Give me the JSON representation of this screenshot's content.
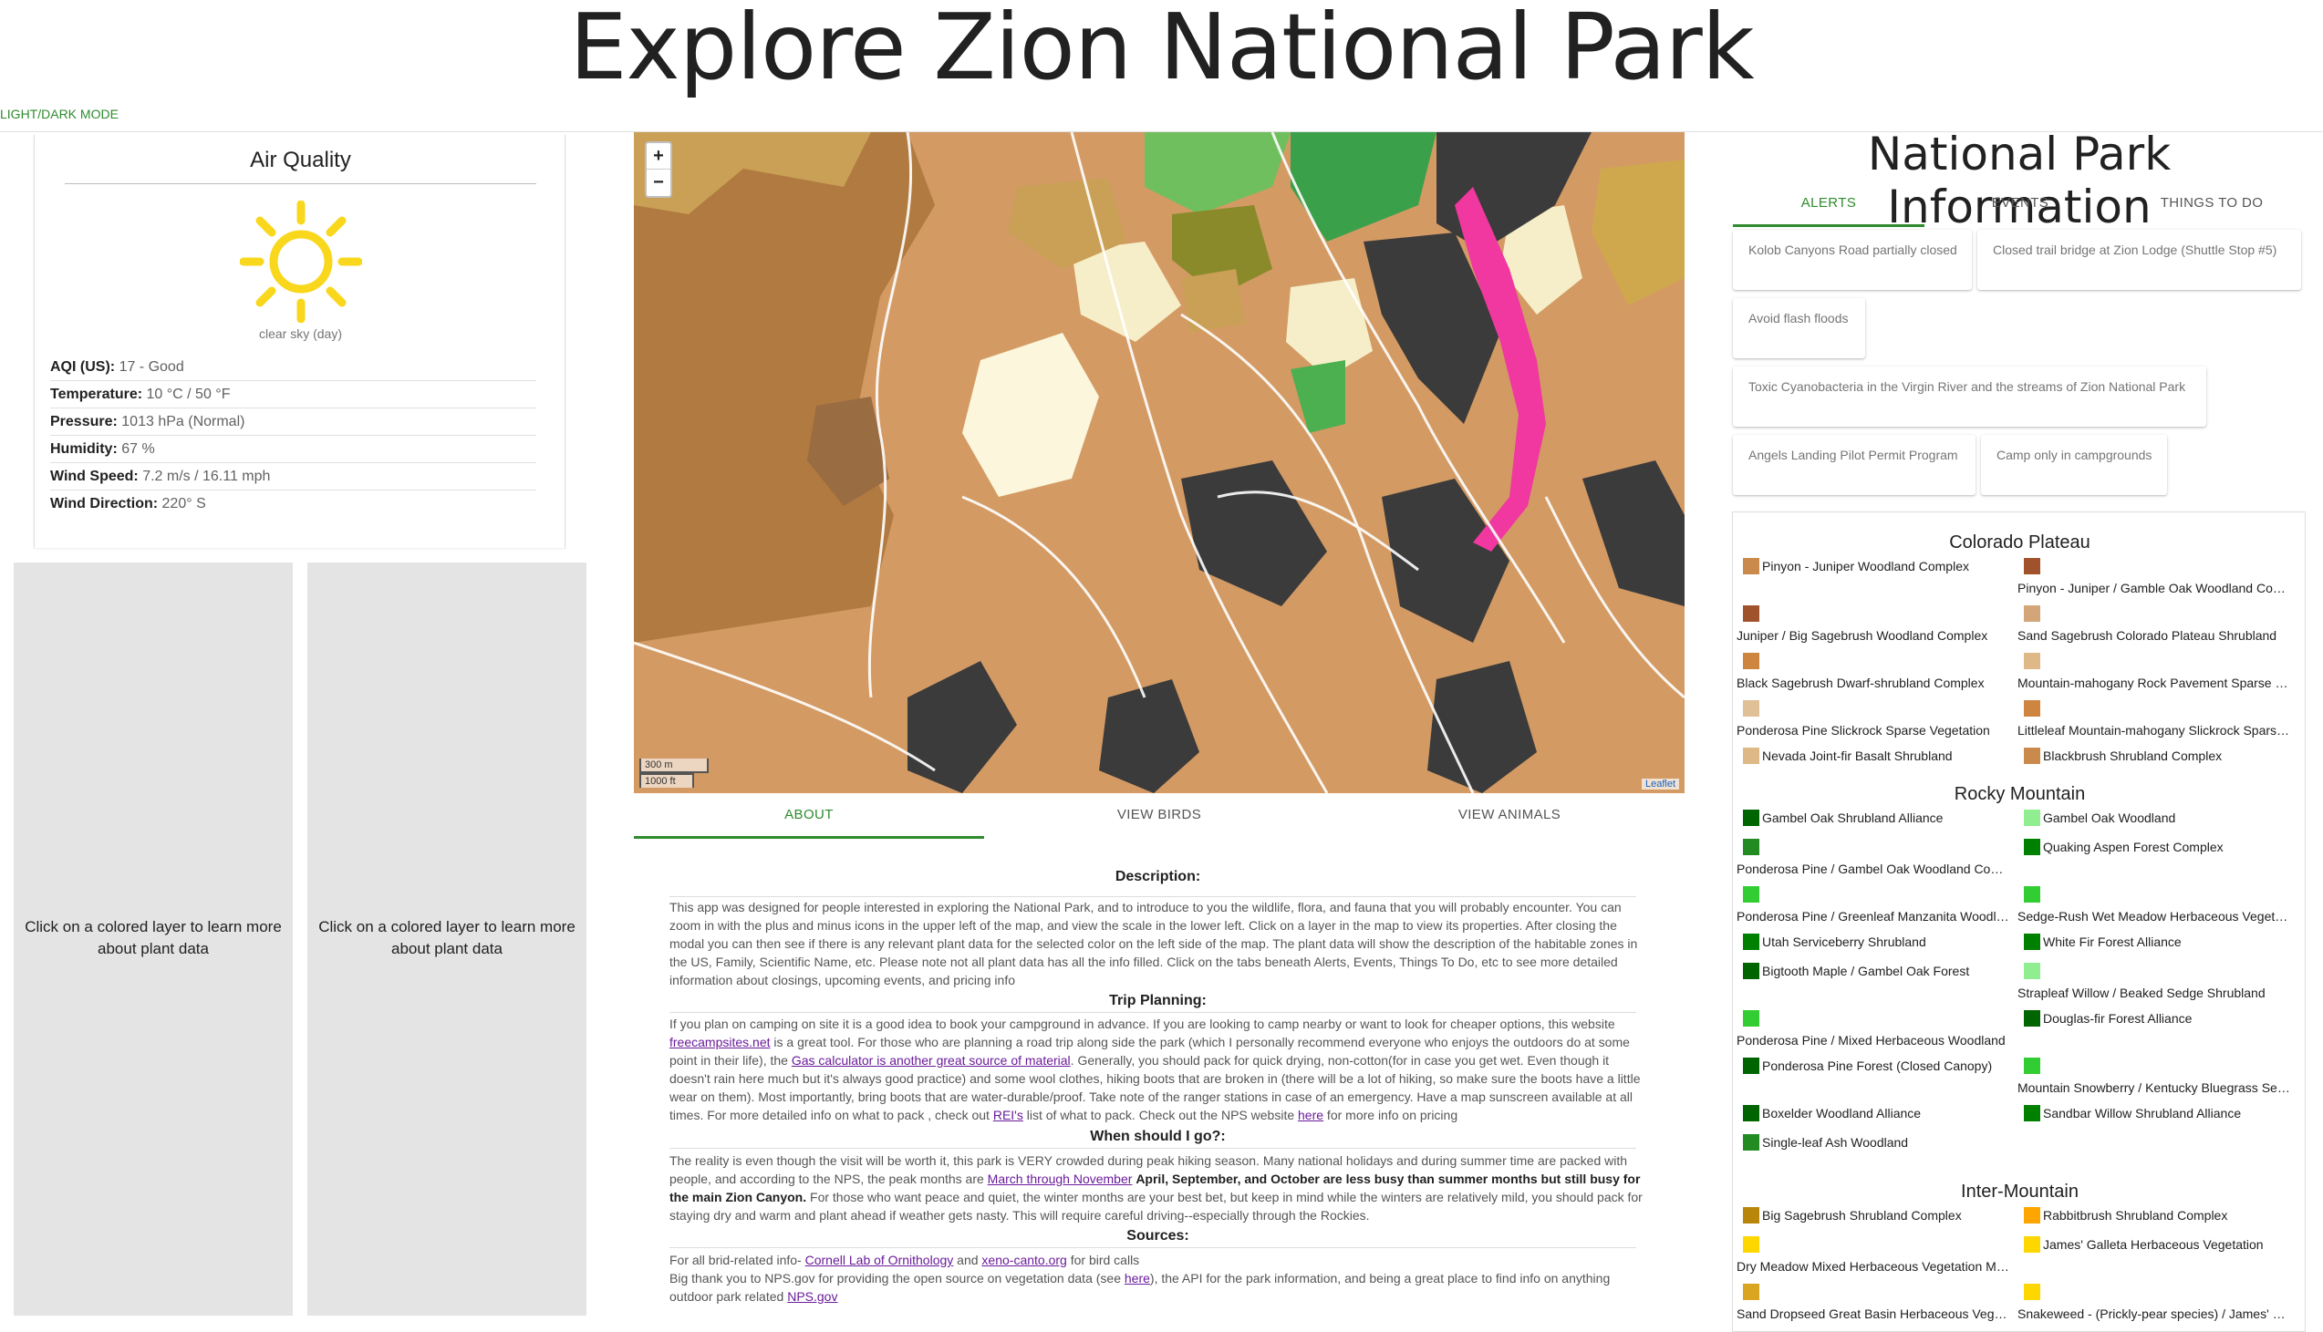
{
  "page": {
    "title": "Explore Zion National Park",
    "mode_toggle": "LIGHT/DARK MODE"
  },
  "air_quality": {
    "title": "Air Quality",
    "icon": "sun-icon",
    "condition": "clear sky (day)",
    "rows": [
      {
        "label": "AQI (US):",
        "value": "17 - Good"
      },
      {
        "label": "Temperature:",
        "value": "10 °C / 50 °F"
      },
      {
        "label": "Pressure:",
        "value": "1013 hPa (Normal)"
      },
      {
        "label": "Humidity:",
        "value": "67 %"
      },
      {
        "label": "Wind Speed:",
        "value": "7.2 m/s / 16.11 mph"
      },
      {
        "label": "Wind Direction:",
        "value": "220° S"
      }
    ]
  },
  "plant_panels": [
    "Click on a colored layer to learn more about plant data",
    "Click on a colored layer to learn more about plant data"
  ],
  "map": {
    "zoom_in": "+",
    "zoom_out": "−",
    "scale_metric": "300 m",
    "scale_imperial": "1000 ft",
    "attribution": "Leaflet"
  },
  "about_tabs": [
    "ABOUT",
    "VIEW BIRDS",
    "VIEW ANIMALS"
  ],
  "about": {
    "description_heading": "Description:",
    "description": "This app was designed for people interested in exploring the National Park, and to introduce to you the wildlife, flora, and fauna that you will probably encounter. You can zoom in with the plus and minus icons in the upper left of the map, and view the scale in the lower left. Click on a layer in the map to view its properties. After closing the modal you can then see if there is any relevant plant data for the selected color on the left side of the map. The plant data will show the description of the habitable zones in the US, Family, Scientific Name, etc. Please note not all plant data has all the info filled. Click on the tabs beneath Alerts, Events, Things To Do, etc to see more detailed information about closings, upcoming events, and pricing info",
    "trip_heading": "Trip Planning:",
    "trip_1": "If you plan on camping on site it is a good idea to book your campground in advance. If you are looking to camp nearby or want to look for cheaper options, this website ",
    "trip_link_1": "freecampsites.net",
    "trip_2": " is a great tool. For those who are planning a road trip along side the park (which I personally recommend everyone who enjoys the outdoors do at some point in their life), the ",
    "trip_link_2": "Gas calculator is another great source of material",
    "trip_3": ". Generally, you should pack for quick drying, non-cotton(for in case you get wet. Even though it doesn't rain here much but it's always good practice) and some wool clothes, hiking boots that are broken in (there will be a lot of hiking, so make sure the boots have a little wear on them). Most importantly, bring boots that are water-durable/proof. Take note of the ranger stations in case of an emergency. Have a map sunscreen available at all times. For more detailed info on what to pack , check out ",
    "trip_link_3": "REI's",
    "trip_4": " list of what to pack. Check out the NPS website ",
    "trip_link_4": "here",
    "trip_5": " for more info on pricing",
    "when_heading": "When should I go?:",
    "when_1": "The reality is even though the visit will be worth it, this park is VERY crowded during peak hiking season. Many national holidays and during summer time are packed with people, and according to the NPS, the peak months are ",
    "when_link": "March through November",
    "when_bold": "April, September, and October are less busy than summer months but still busy for the main Zion Canyon.",
    "when_2": " For those who want peace and quiet, the winter months are your best bet, but keep in mind while the winters are relatively mild, you should pack for staying dry and warm and plant ahead if weather gets nasty. This will require careful driving--especially through the Rockies.",
    "sources_heading": "Sources:",
    "src_1": "For all brid-related info- ",
    "src_link_1": "Cornell Lab of Ornithology",
    "src_2": " and ",
    "src_link_2": "xeno-canto.org",
    "src_3": " for bird calls",
    "src_4": "Big thank you to NPS.gov for providing the open source on vegetation data (see ",
    "src_link_3": "here",
    "src_5": "), the API for the park information, and being a great place to find info on anything outdoor park related ",
    "src_link_4": "NPS.gov"
  },
  "park_info": {
    "title": "National Park Information",
    "tabs": [
      "ALERTS",
      "EVENTS",
      "THINGS TO DO"
    ],
    "alerts": [
      "Kolob Canyons Road partially closed",
      "Closed trail bridge at Zion Lodge (Shuttle Stop #5)",
      "Avoid flash floods",
      "Toxic Cyanobacteria in the Virgin River and the streams of Zion National Park",
      "Angels Landing Pilot Permit Program",
      "Camp only in campgrounds"
    ]
  },
  "legend": {
    "groups": [
      {
        "name": "Colorado Plateau",
        "items": [
          {
            "label": "Pinyon - Juniper Woodland Complex",
            "color": "#c98a4b"
          },
          {
            "label": "Pinyon - Juniper / Gamble Oak Woodland Complex",
            "color": "#a0522d"
          },
          {
            "label": "Juniper / Big Sagebrush Woodland Complex",
            "color": "#a0522d"
          },
          {
            "label": "Sand Sagebrush Colorado Plateau Shrubland",
            "color": "#d2a679"
          },
          {
            "label": "Black Sagebrush Dwarf-shrubland Complex",
            "color": "#cd853f"
          },
          {
            "label": "Mountain-mahogany Rock Pavement Sparse Vegetation",
            "color": "#deb887"
          },
          {
            "label": "Ponderosa Pine Slickrock Sparse Vegetation",
            "color": "#e0c097"
          },
          {
            "label": "Littleleaf Mountain-mahogany Slickrock Sparse Vegetation",
            "color": "#cd853f"
          },
          {
            "label": "Nevada Joint-fir Basalt Shrubland",
            "color": "#deb887"
          },
          {
            "label": "Blackbrush Shrubland Complex",
            "color": "#c98a4b"
          }
        ]
      },
      {
        "name": "Rocky Mountain",
        "items": [
          {
            "label": "Gambel Oak Shrubland Alliance",
            "color": "#006400"
          },
          {
            "label": "Gambel Oak Woodland",
            "color": "#90ee90"
          },
          {
            "label": "Ponderosa Pine / Gambel Oak Woodland Complex",
            "color": "#228b22"
          },
          {
            "label": "Quaking Aspen Forest Complex",
            "color": "#008000"
          },
          {
            "label": "Ponderosa Pine / Greenleaf Manzanita Woodland",
            "color": "#32cd32"
          },
          {
            "label": "Sedge-Rush Wet Meadow Herbaceous Vegetation",
            "color": "#32cd32"
          },
          {
            "label": "Utah Serviceberry Shrubland",
            "color": "#008000"
          },
          {
            "label": "White Fir Forest Alliance",
            "color": "#008000"
          },
          {
            "label": "Bigtooth Maple / Gambel Oak Forest",
            "color": "#006400"
          },
          {
            "label": "Strapleaf Willow / Beaked Sedge Shrubland",
            "color": "#90ee90"
          },
          {
            "label": "Ponderosa Pine / Mixed Herbaceous Woodland",
            "color": "#32cd32"
          },
          {
            "label": "Douglas-fir Forest Alliance",
            "color": "#006400"
          },
          {
            "label": "Ponderosa Pine Forest (Closed Canopy)",
            "color": "#006400"
          },
          {
            "label": "Mountain Snowberry / Kentucky Bluegrass Series",
            "color": "#32cd32"
          },
          {
            "label": "Boxelder Woodland Alliance",
            "color": "#006400"
          },
          {
            "label": "Sandbar Willow Shrubland Alliance",
            "color": "#008000"
          },
          {
            "label": "Single-leaf Ash Woodland",
            "color": "#228b22"
          }
        ]
      },
      {
        "name": "Inter-Mountain",
        "items": [
          {
            "label": "Big Sagebrush Shrubland Complex",
            "color": "#b8860b"
          },
          {
            "label": "Rabbitbrush Shrubland Complex",
            "color": "#ffa500"
          },
          {
            "label": "Dry Meadow Mixed Herbaceous Vegetation Mosaic",
            "color": "#ffd700"
          },
          {
            "label": "James' Galleta Herbaceous Vegetation",
            "color": "#ffd700"
          },
          {
            "label": "Sand Dropseed Great Basin Herbaceous Vegetation",
            "color": "#daa520"
          },
          {
            "label": "Snakeweed - (Prickly-pear species) / James' Galleta",
            "color": "#ffd700"
          }
        ]
      }
    ]
  }
}
